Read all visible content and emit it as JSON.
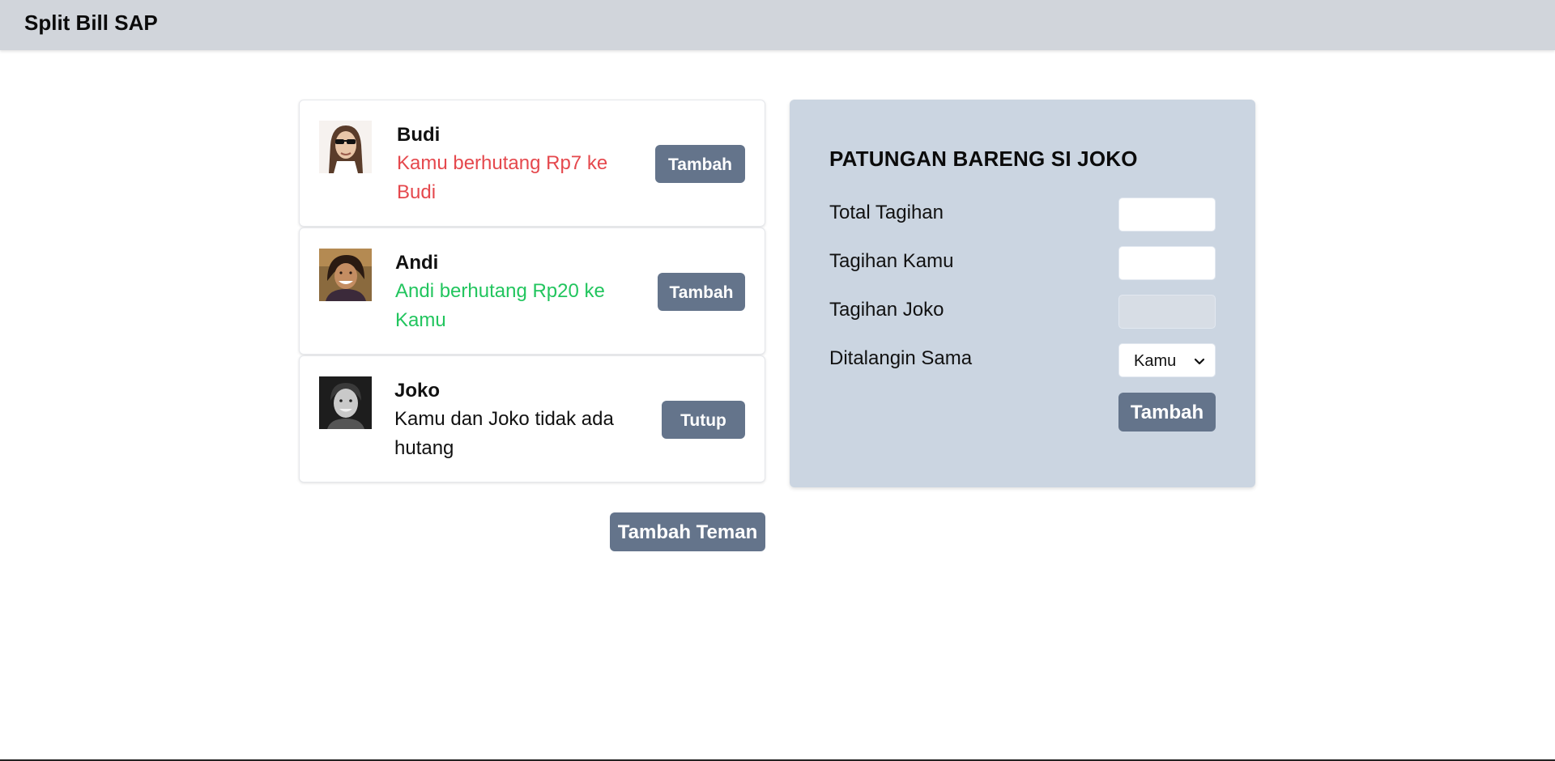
{
  "app": {
    "title": "Split Bill SAP"
  },
  "friends": [
    {
      "name": "Budi",
      "status": "Kamu berhutang Rp7 ke Budi",
      "status_kind": "owe",
      "button_label": "Tambah",
      "avatar_icon": "avatar-long-hair-sunglasses"
    },
    {
      "name": "Andi",
      "status": "Andi berhutang Rp20 ke Kamu",
      "status_kind": "owed",
      "button_label": "Tambah",
      "avatar_icon": "avatar-smiling-woman"
    },
    {
      "name": "Joko",
      "status": "Kamu dan Joko tidak ada hutang",
      "status_kind": "even",
      "button_label": "Tutup",
      "avatar_icon": "avatar-bw-portrait"
    }
  ],
  "add_friend_label": "Tambah Teman",
  "split_form": {
    "title": "PATUNGAN BARENG SI JOKO",
    "fields": {
      "total_label": "Total Tagihan",
      "total_value": "",
      "yours_label": "Tagihan Kamu",
      "yours_value": "",
      "friend_label": "Tagihan Joko",
      "friend_value": "",
      "payer_label": "Ditalangin Sama",
      "payer_value": "Kamu"
    },
    "submit_label": "Tambah"
  },
  "colors": {
    "header_bg": "#d1d5db",
    "panel_bg": "#cbd5e1",
    "button_bg": "#64748b",
    "owe_text": "#e5484d",
    "owed_text": "#22c55e"
  }
}
